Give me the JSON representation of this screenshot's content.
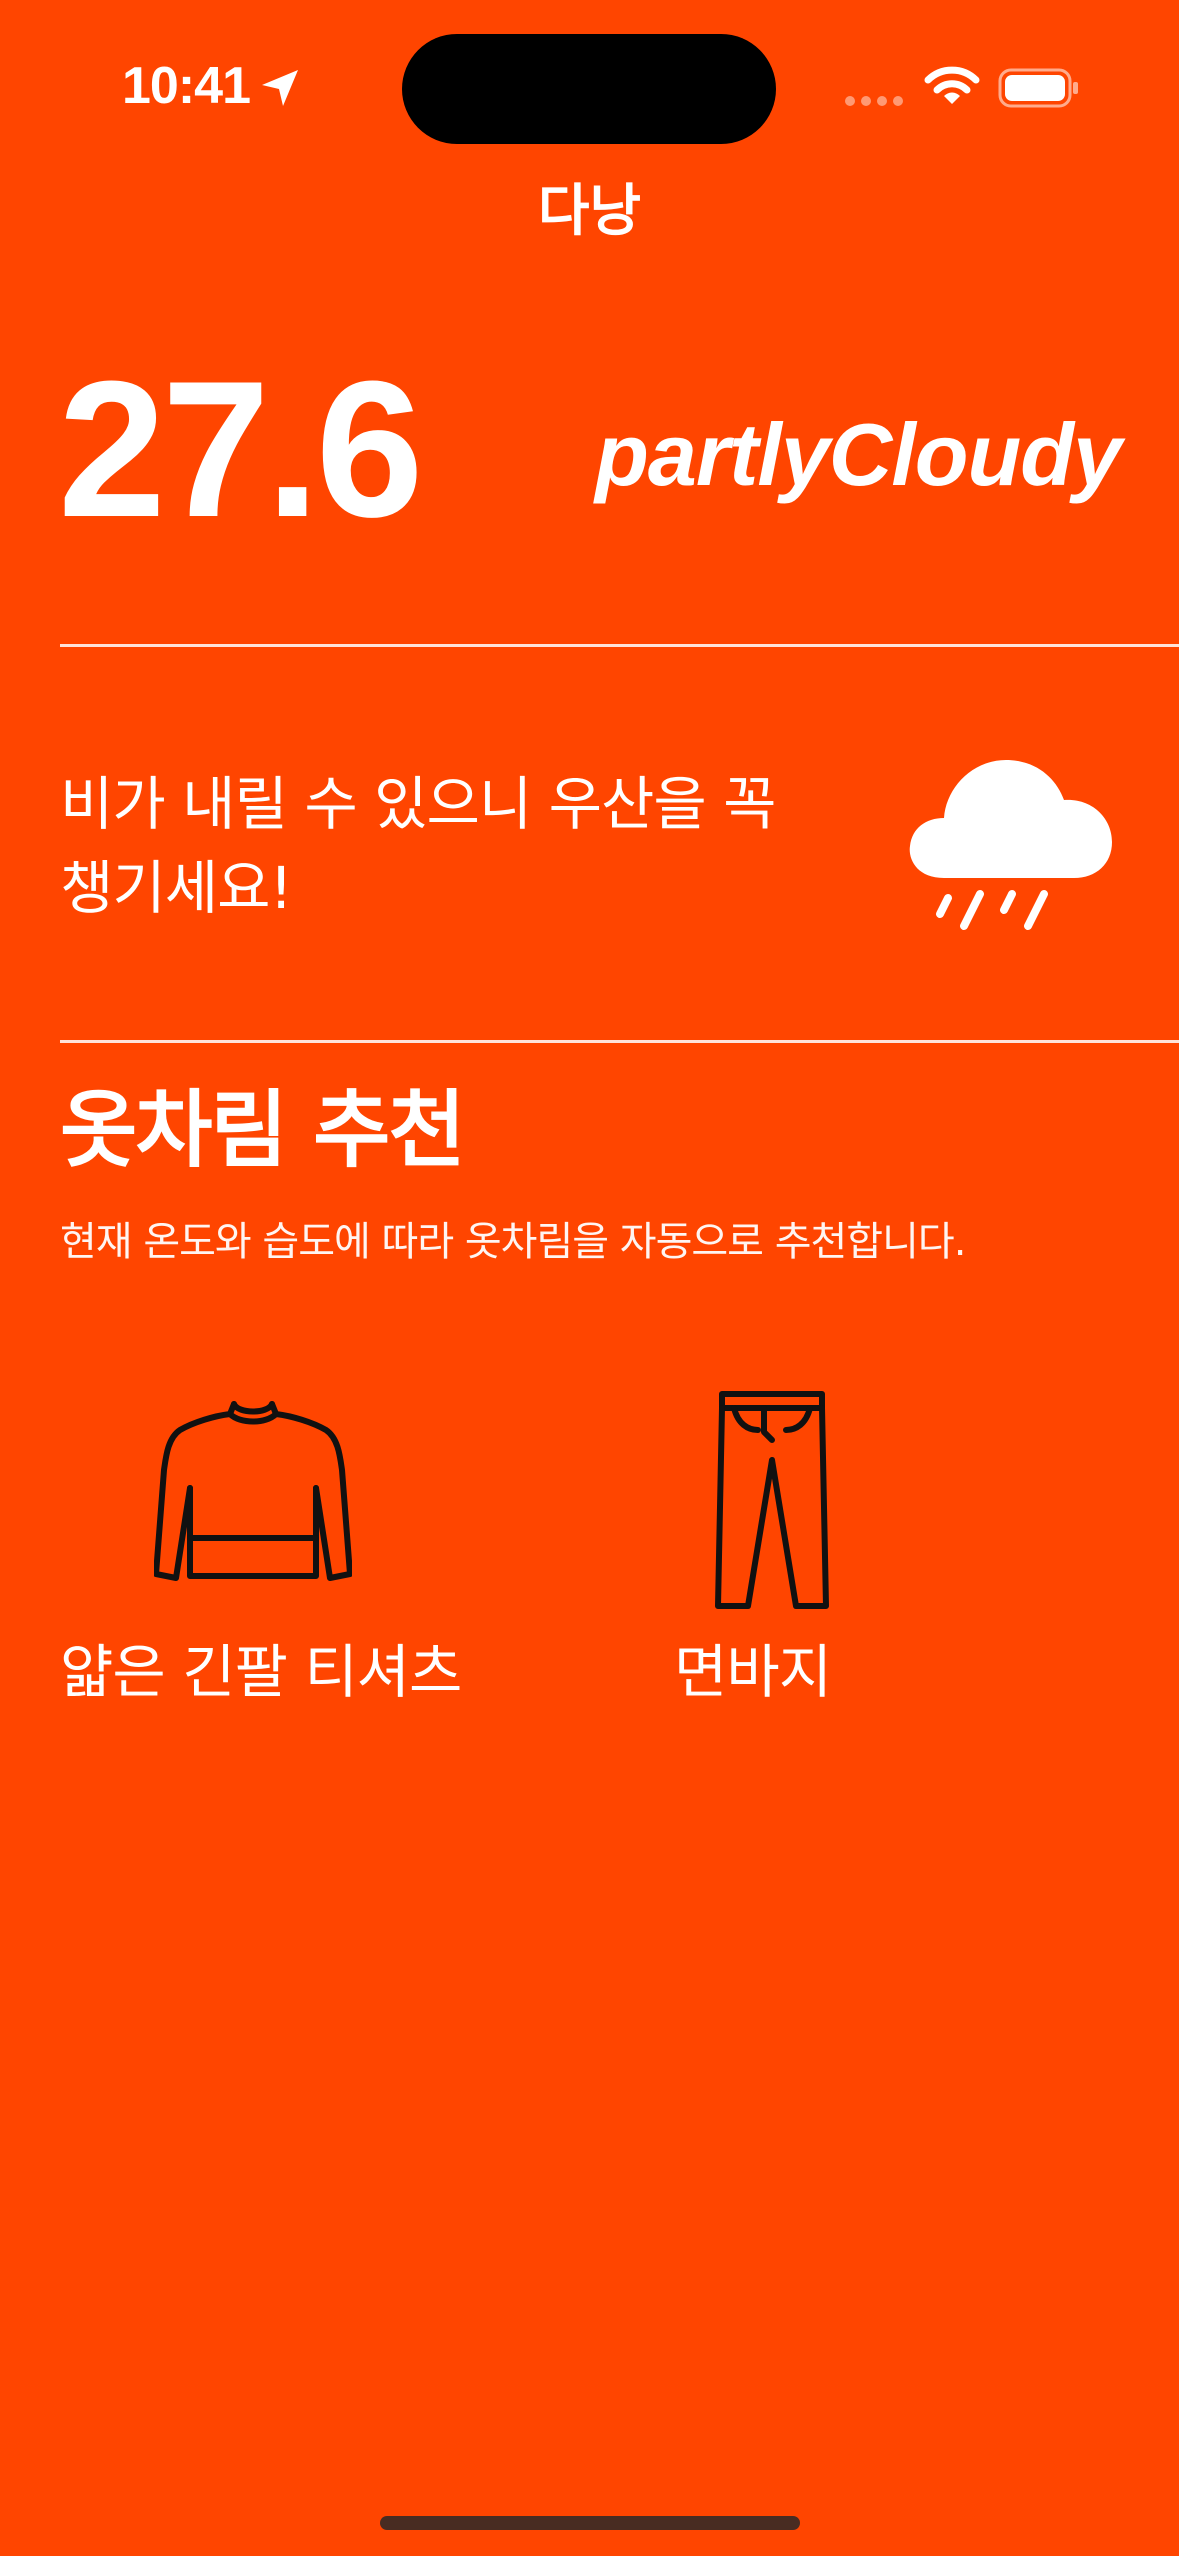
{
  "theme": {
    "background": "#FF4500",
    "text": "#FFFFFF",
    "icon_line": "#111111"
  },
  "status_bar": {
    "time": "10:41",
    "icons": [
      "location-arrow-icon",
      "signal-icon",
      "wifi-icon",
      "battery-icon"
    ]
  },
  "header": {
    "city": "다낭"
  },
  "weather": {
    "temperature": "27.6",
    "condition": "partlyCloudy",
    "advice": "비가 내릴 수 있으니 우산을 꼭 챙기세요!",
    "icon": "rain-cloud-icon"
  },
  "outfit": {
    "title": "옷차림 추천",
    "description": "현재 온도와 습도에 따라 옷차림을 자동으로 추천합니다.",
    "items": [
      {
        "label": "얇은 긴팔 티셔츠",
        "icon": "long-sleeve-shirt-icon"
      },
      {
        "label": "면바지",
        "icon": "pants-icon"
      }
    ]
  }
}
